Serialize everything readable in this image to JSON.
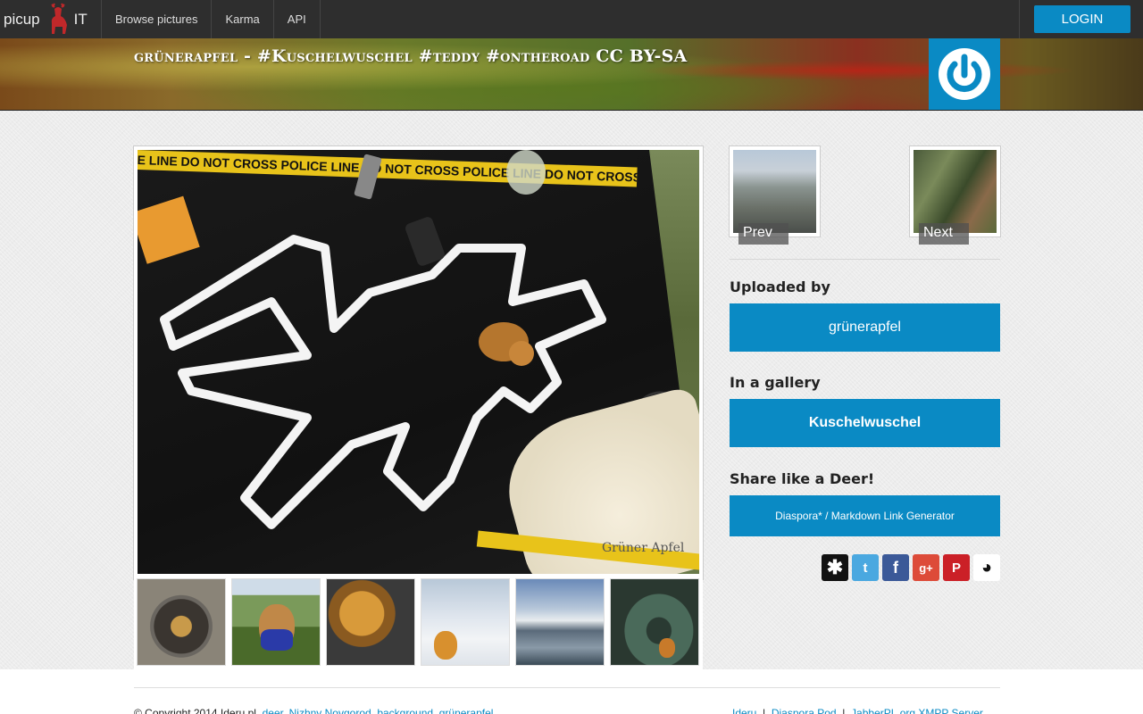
{
  "navbar": {
    "brand_left": "picup",
    "brand_right": "IT",
    "items": [
      {
        "label": "Browse pictures"
      },
      {
        "label": "Karma"
      },
      {
        "label": "API"
      }
    ],
    "login_label": "LOGIN"
  },
  "banner": {
    "title": "grünerapfel - #Kuschelwuschel #teddy #ontheroad CC BY-SA"
  },
  "photo": {
    "tape_text": "E LINE DO NOT CROSS   POLICE LINE DO NOT CROSS   POLICE LINE DO NOT CROSS",
    "watermark": "Grüner Apfel"
  },
  "sidebar": {
    "prev_label": "Prev",
    "next_label": "Next",
    "uploaded_by_heading": "Uploaded by",
    "uploader": "grünerapfel",
    "gallery_heading": "In a gallery",
    "gallery": "Kuschelwuschel",
    "share_heading": "Share like a Deer!",
    "link_generator": "Diaspora* / Markdown Link Generator",
    "share_icons": [
      {
        "name": "diaspora-icon",
        "glyph": "✱",
        "color": "#111111"
      },
      {
        "name": "twitter-icon",
        "glyph": "t",
        "color": "#4aa8e0"
      },
      {
        "name": "facebook-icon",
        "glyph": "f",
        "color": "#3b5998"
      },
      {
        "name": "google-plus-icon",
        "glyph": "g+",
        "color": "#dd4b39"
      },
      {
        "name": "pinterest-icon",
        "glyph": "P",
        "color": "#cb2027"
      },
      {
        "name": "reddit-icon",
        "glyph": "◕",
        "color": "#ffffff"
      }
    ]
  },
  "footer": {
    "copyright": "© Copyright 2014 Ideru.pl",
    "links_left": [
      "deer",
      "Nizhny Novgorod, background",
      "grünerapfel"
    ],
    "links_right": [
      "Ideru",
      "Diaspora Pod",
      "JabberPL.org XMPP Server"
    ]
  },
  "colors": {
    "accent": "#0a8ac4",
    "navbar": "#2e2e2e"
  }
}
